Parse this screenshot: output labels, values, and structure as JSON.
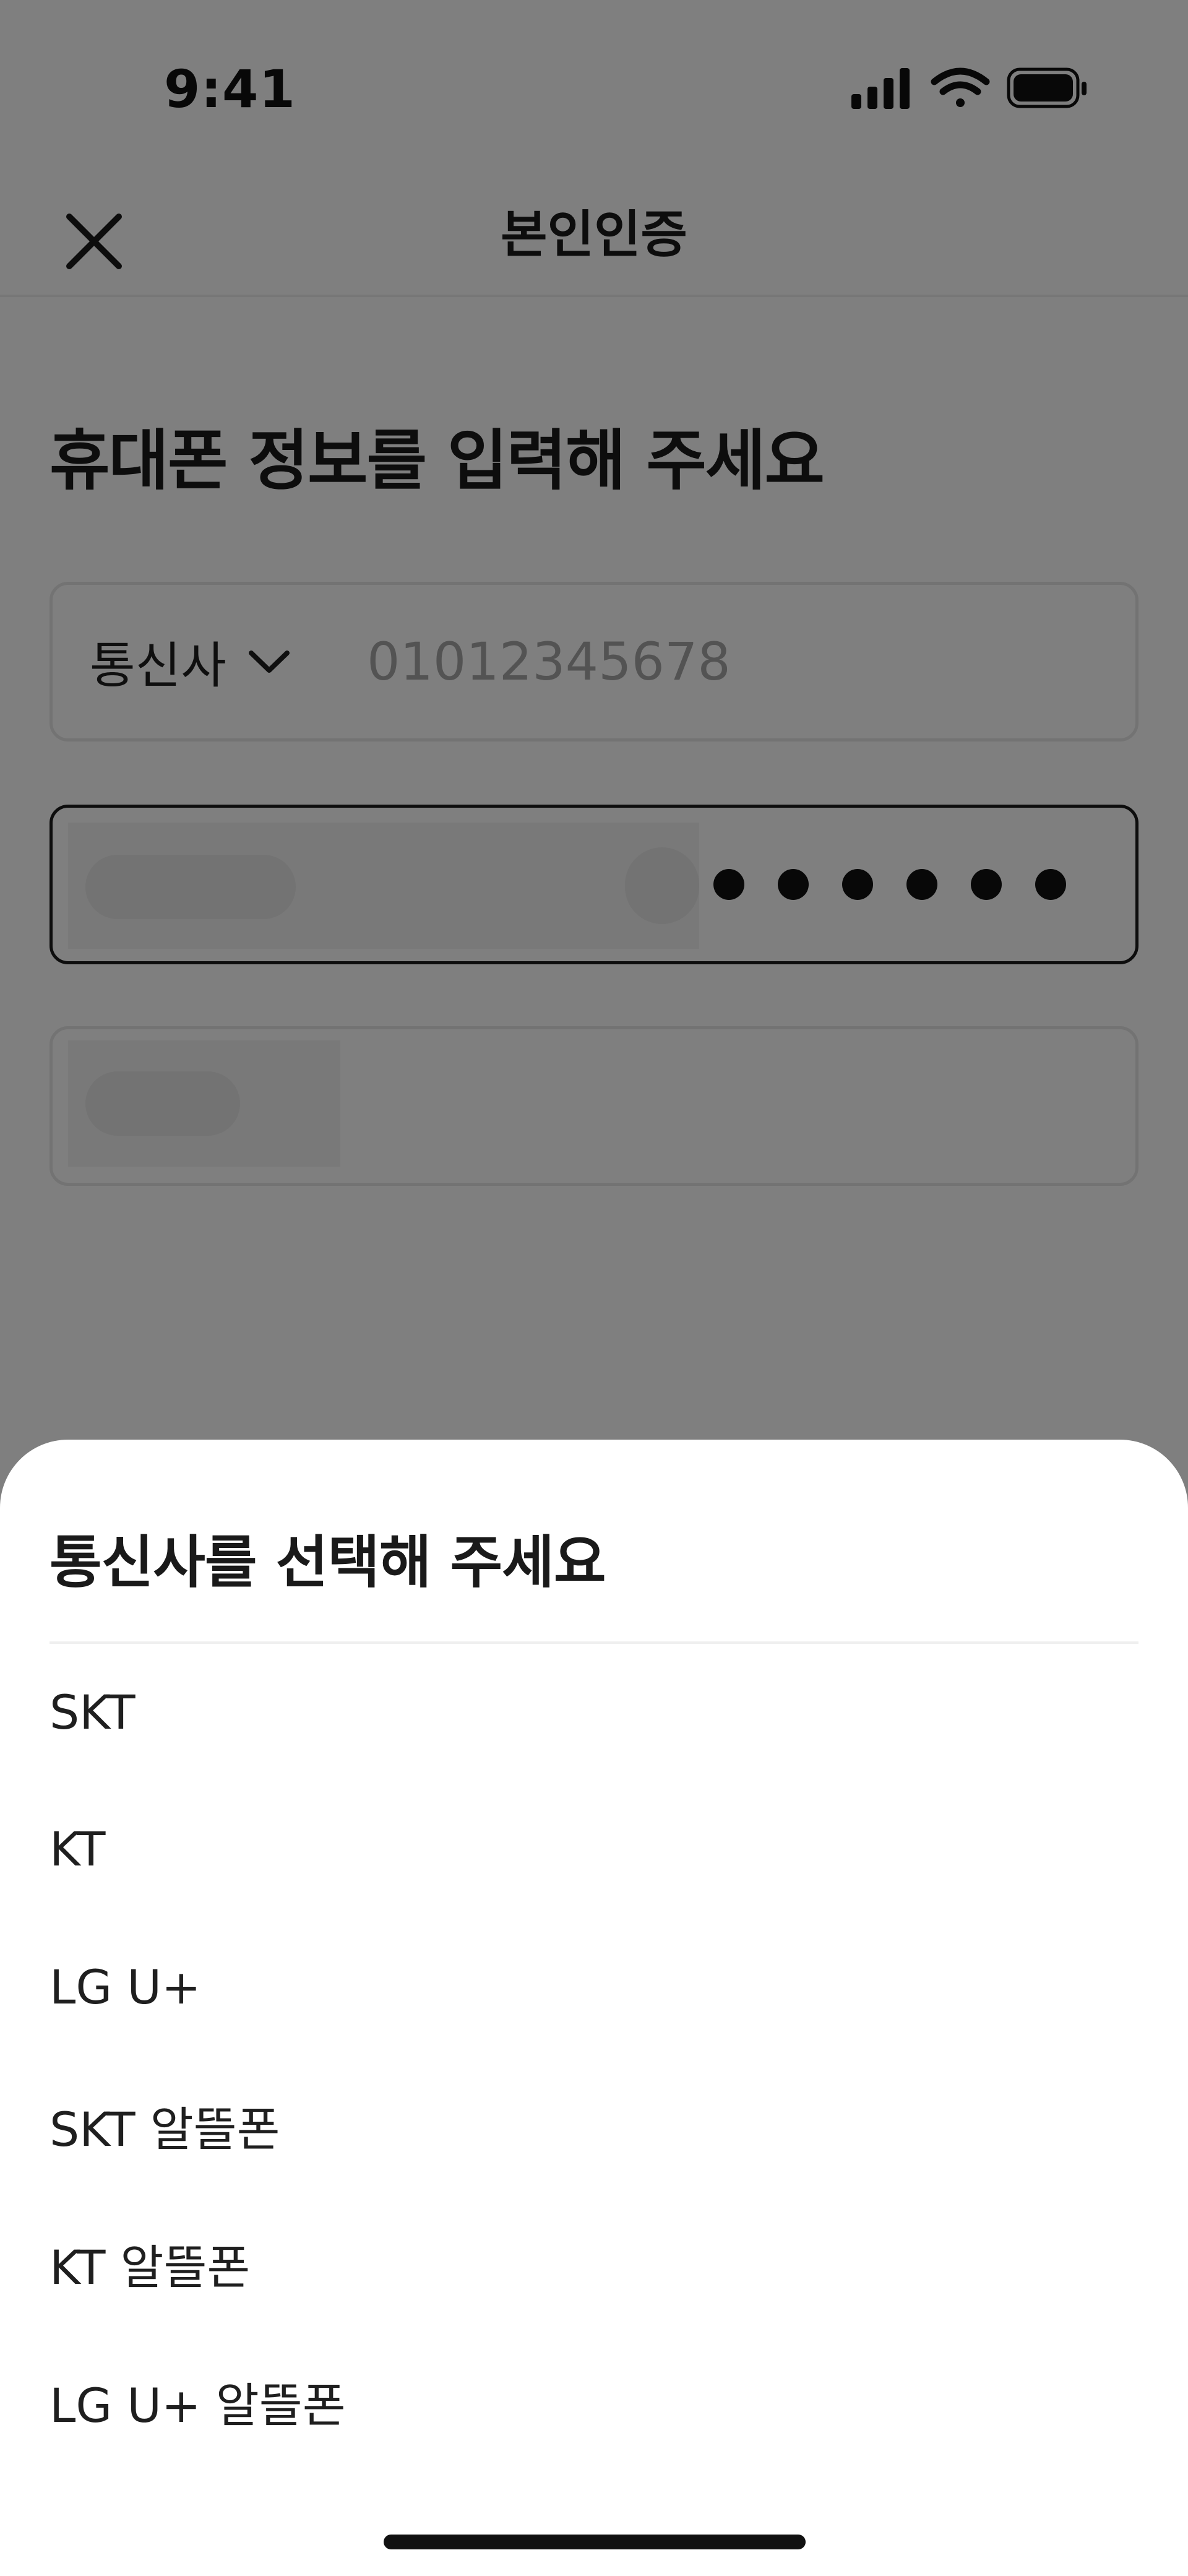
{
  "status_bar": {
    "time": "9:41",
    "icons": [
      "cellular-signal-icon",
      "wifi-icon",
      "battery-icon"
    ]
  },
  "header": {
    "title": "본인인증",
    "close_icon": "close-icon"
  },
  "page": {
    "heading": "휴대폰 정보를 입력해 주세요",
    "carrier_label": "통신사",
    "phone_placeholder": "01012345678",
    "id_masked_digits": 6
  },
  "sheet": {
    "title": "통신사를 선택해 주세요",
    "options": [
      "SKT",
      "KT",
      "LG U+",
      "SKT 알뜰폰",
      "KT 알뜰폰",
      "LG U+ 알뜰폰"
    ]
  },
  "colors": {
    "overlay": "rgba(0,0,0,0.5)",
    "text": "#1f1f1f",
    "placeholder": "#a7a7a7",
    "border": "#e6e6e6",
    "focused_border": "#1a1a1a"
  }
}
